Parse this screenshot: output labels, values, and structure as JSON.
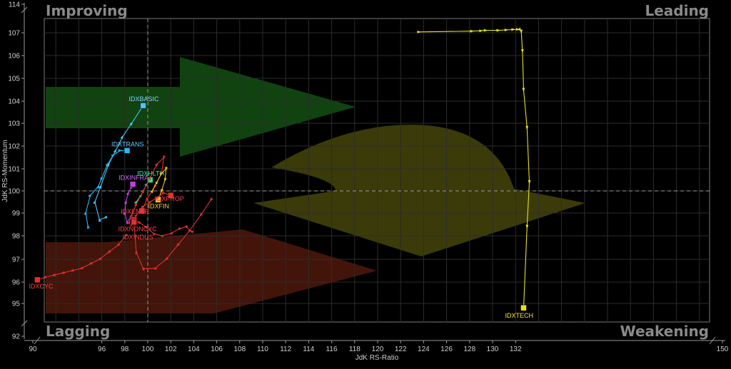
{
  "chart_data": {
    "type": "scatter",
    "title": "",
    "xlabel": "JdK RS-Ratio",
    "ylabel": "JdK RS-Momentum",
    "xlim": [
      90,
      150
    ],
    "ylim": [
      92,
      114
    ],
    "x_ticks": [
      "90",
      "92",
      "94",
      "96",
      "98",
      "100",
      "102",
      "104",
      "106",
      "108",
      "110",
      "112",
      "114",
      "116",
      "118",
      "120",
      "122",
      "124",
      "126",
      "128",
      "130",
      "132",
      "134",
      "136",
      "138",
      "140",
      "142",
      "144",
      "146",
      "148",
      "150"
    ],
    "x_tick_labels": [
      "90",
      "",
      "",
      "96",
      "98",
      "100",
      "102",
      "104",
      "106",
      "108",
      "110",
      "112",
      "114",
      "116",
      "118",
      "120",
      "122",
      "124",
      "126",
      "128",
      "130",
      "132",
      "",
      "",
      "",
      "",
      "",
      "",
      "",
      "",
      "150"
    ],
    "y_ticks": [
      {
        "value": 92,
        "label": "92"
      },
      {
        "value": 95,
        "label": "95"
      },
      {
        "value": 96,
        "label": "96"
      },
      {
        "value": 97,
        "label": "97"
      },
      {
        "value": 98,
        "label": "98"
      },
      {
        "value": 99,
        "label": "99"
      },
      {
        "value": 100,
        "label": "100"
      },
      {
        "value": 101,
        "label": "101"
      },
      {
        "value": 102,
        "label": "102"
      },
      {
        "value": 103,
        "label": "103"
      },
      {
        "value": 104,
        "label": "104"
      },
      {
        "value": 105,
        "label": "105"
      },
      {
        "value": 106,
        "label": "106"
      },
      {
        "value": 107,
        "label": "107"
      },
      {
        "value": 114,
        "label": "114"
      }
    ],
    "quadrants": {
      "top_left": "Improving",
      "top_right": "Leading",
      "bottom_left": "Lagging",
      "bottom_right": "Weakening"
    },
    "center": {
      "x": 100,
      "y": 100
    },
    "grid": true,
    "series": [
      {
        "name": "IDXBASIC",
        "color": "#4fc3f7",
        "label_color": "#7fd8ff",
        "x": [
          96.3,
          95.8,
          95.4,
          95.9,
          96.6,
          97.2,
          97.8,
          98.6,
          99.6
        ],
        "y": [
          98.8,
          98.7,
          99.5,
          100.2,
          101.2,
          101.8,
          102.4,
          103.0,
          103.8
        ]
      },
      {
        "name": "IDXTRANS",
        "color": "#29b6f6",
        "label_color": "#5fc8ff",
        "x": [
          94.8,
          94.6,
          95.0,
          95.7,
          96.0,
          96.5,
          97.0,
          97.6,
          98.2
        ],
        "y": [
          98.4,
          99.0,
          99.8,
          100.2,
          100.6,
          101.2,
          101.6,
          101.8,
          101.8
        ]
      },
      {
        "name": "IDXINFRA",
        "color": "#c040e0",
        "label_color": "#d070ff",
        "x": [
          98.5,
          98.2,
          98.0,
          98.1,
          98.3,
          98.6,
          98.7
        ],
        "y": [
          98.8,
          98.6,
          99.0,
          99.5,
          99.9,
          100.2,
          100.3
        ]
      },
      {
        "name": "IDXHLTH",
        "color": "#20e090",
        "label_color": "#40f0a0",
        "x": [
          99.0,
          99.4,
          99.6,
          99.9,
          100.2
        ],
        "y": [
          99.5,
          99.8,
          100.0,
          100.3,
          100.5
        ]
      },
      {
        "name": "IDXENER",
        "color": "#e03030",
        "label_color": "#ff4040",
        "x": [
          98.4,
          98.6,
          99.0,
          99.6,
          100.2,
          100.8,
          101.4,
          101.2,
          100.6,
          99.9,
          99.5
        ],
        "y": [
          98.6,
          98.9,
          99.4,
          100.0,
          100.6,
          101.2,
          101.5,
          100.8,
          100.2,
          99.6,
          99.1
        ]
      },
      {
        "name": "IDXFIN",
        "color": "#f0c020",
        "label_color": "#ffd030",
        "x": [
          100.4,
          100.8,
          101.2,
          101.6,
          101.5,
          101.2,
          100.9
        ],
        "y": [
          100.0,
          100.4,
          100.8,
          101.0,
          100.5,
          100.0,
          99.6
        ]
      },
      {
        "name": "IDXPROP",
        "color": "#e03030",
        "label_color": "#ff4040",
        "x": [
          98.6,
          99.0,
          99.6,
          100.2,
          100.8,
          101.4,
          102.0
        ],
        "y": [
          98.5,
          98.9,
          99.3,
          99.5,
          99.7,
          99.9,
          99.8
        ]
      },
      {
        "name": "IDXNONCYC",
        "color": "#e03030",
        "label_color": "#ff4040",
        "x": [
          103.8,
          103.3,
          102.7,
          102.0,
          101.2,
          100.5,
          99.8,
          99.2,
          98.8
        ],
        "y": [
          98.2,
          98.4,
          98.3,
          98.1,
          98.0,
          98.1,
          98.4,
          98.6,
          98.7
        ]
      },
      {
        "name": "IDXINDUS",
        "color": "#e03030",
        "label_color": "#ff4040",
        "x": [
          105.5,
          104.6,
          103.6,
          102.6,
          101.6,
          100.6,
          99.6,
          99.0,
          98.8
        ],
        "y": [
          99.6,
          98.9,
          98.2,
          97.6,
          97.0,
          96.6,
          96.6,
          97.3,
          98.6
        ]
      },
      {
        "name": "IDXCYC",
        "color": "#e03030",
        "label_color": "#ff4040",
        "x": [
          98.1,
          97.4,
          96.6,
          95.8,
          95.0,
          94.2,
          93.4,
          92.6,
          91.8,
          91.0,
          90.4
        ],
        "y": [
          98.0,
          97.6,
          97.3,
          97.0,
          96.8,
          96.6,
          96.5,
          96.4,
          96.3,
          96.2,
          96.1
        ]
      },
      {
        "name": "IDXTECH",
        "color": "#e8e020",
        "label_color": "#f0e840",
        "x": [
          123.6,
          128.2,
          129.0,
          129.4,
          130.5,
          131.2,
          131.8,
          132.2,
          132.4,
          132.5,
          132.6,
          132.7,
          133.0,
          133.2,
          133.0,
          132.7
        ],
        "y": [
          107.2,
          107.4,
          107.5,
          107.6,
          107.6,
          107.7,
          107.8,
          107.8,
          107.7,
          107.3,
          106.2,
          104.5,
          102.8,
          100.4,
          98.4,
          94.6
        ]
      }
    ]
  }
}
